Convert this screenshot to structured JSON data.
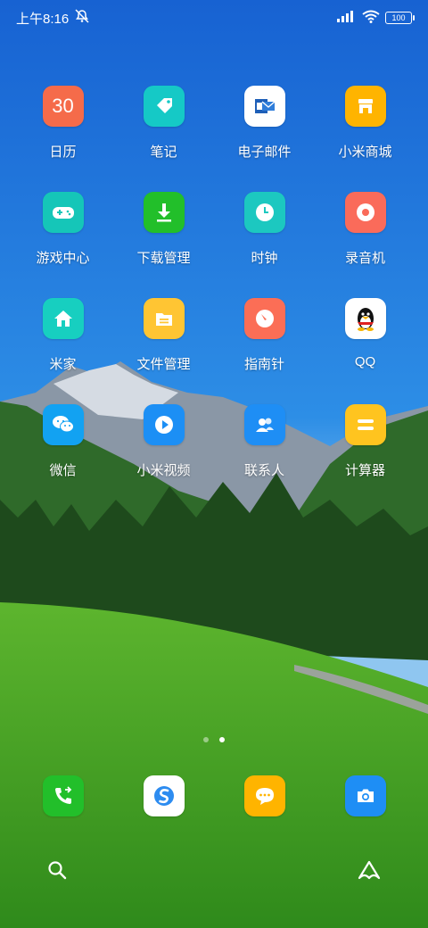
{
  "status_bar": {
    "time": "上午8:16",
    "battery": "100"
  },
  "apps": [
    {
      "label": "日历",
      "icon": "calendar-icon",
      "color": "#F56B4A",
      "text": "30"
    },
    {
      "label": "笔记",
      "icon": "notes-icon",
      "color": "#15C9C6"
    },
    {
      "label": "电子邮件",
      "icon": "email-icon",
      "color": "#FFFFFF"
    },
    {
      "label": "小米商城",
      "icon": "mi-store-icon",
      "color": "#FFB400"
    },
    {
      "label": "游戏中心",
      "icon": "gamepad-icon",
      "color": "#15C6B8"
    },
    {
      "label": "下载管理",
      "icon": "download-icon",
      "color": "#22BF2A"
    },
    {
      "label": "时钟",
      "icon": "clock-icon",
      "color": "#1CC8C0"
    },
    {
      "label": "录音机",
      "icon": "recorder-icon",
      "color": "#FA6B5A"
    },
    {
      "label": "米家",
      "icon": "home-icon",
      "color": "#17CFC0"
    },
    {
      "label": "文件管理",
      "icon": "folder-icon",
      "color": "#FFC533"
    },
    {
      "label": "指南针",
      "icon": "compass-icon",
      "color": "#FB6E56"
    },
    {
      "label": "QQ",
      "icon": "qq-penguin-icon",
      "color": "#FFFFFF"
    },
    {
      "label": "微信",
      "icon": "wechat-icon",
      "color": "#12A2F2"
    },
    {
      "label": "小米视频",
      "icon": "video-play-icon",
      "color": "#1C8FF5"
    },
    {
      "label": "联系人",
      "icon": "contacts-icon",
      "color": "#1E8EF5"
    },
    {
      "label": "计算器",
      "icon": "calculator-icon",
      "color": "#FFC41F"
    }
  ],
  "dock": [
    {
      "icon": "phone-icon",
      "color": "#22BF2A"
    },
    {
      "icon": "browser-icon",
      "color": "#FFFFFF"
    },
    {
      "icon": "messages-icon",
      "color": "#FFB400"
    },
    {
      "icon": "camera-icon",
      "color": "#1E8EF5"
    }
  ]
}
